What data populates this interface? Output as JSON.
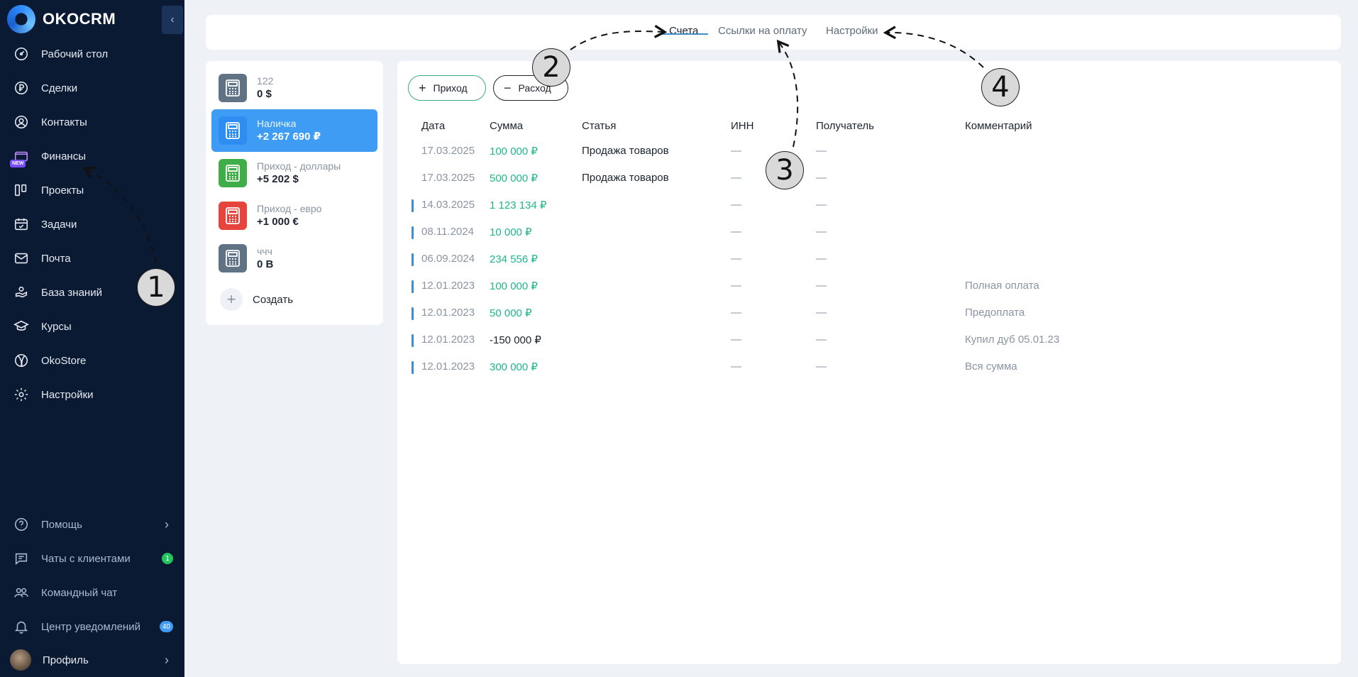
{
  "brand": {
    "name": "OKOCRM"
  },
  "sidebar": {
    "collapse_icon": "chevron-left-icon",
    "items": [
      {
        "label": "Рабочий стол",
        "icon": "dashboard-icon"
      },
      {
        "label": "Сделки",
        "icon": "ruble-circle-icon"
      },
      {
        "label": "Контакты",
        "icon": "user-circle-icon"
      },
      {
        "label": "Финансы",
        "icon": "wallet-icon",
        "badge": "NEW"
      },
      {
        "label": "Проекты",
        "icon": "kanban-icon"
      },
      {
        "label": "Задачи",
        "icon": "calendar-check-icon"
      },
      {
        "label": "Почта",
        "icon": "mail-icon"
      },
      {
        "label": "База знаний",
        "icon": "hand-book-icon"
      },
      {
        "label": "Курсы",
        "icon": "graduation-cap-icon"
      },
      {
        "label": "OkoStore",
        "icon": "globe-icon"
      },
      {
        "label": "Настройки",
        "icon": "gear-icon"
      }
    ],
    "bottom": [
      {
        "label": "Помощь",
        "icon": "question-icon"
      },
      {
        "label": "Чаты с клиентами",
        "icon": "chat-icon",
        "count": "1",
        "count_color": "#22c55e"
      },
      {
        "label": "Командный чат",
        "icon": "team-icon"
      },
      {
        "label": "Центр уведомлений",
        "icon": "bell-icon",
        "count": "40",
        "count_color": "#3e9cf5"
      },
      {
        "label": "Профиль",
        "icon": "avatar"
      }
    ]
  },
  "tabs": [
    {
      "label": "Счета",
      "active": true
    },
    {
      "label": "Ссылки на оплату",
      "active": false
    },
    {
      "label": "Настройки",
      "active": false
    }
  ],
  "accounts": {
    "items": [
      {
        "name": "122",
        "value": "0 $",
        "color": "#5f7385"
      },
      {
        "name": "Наличка",
        "value": "+2 267 690 ₽",
        "color": "#2f8cf0",
        "active": true
      },
      {
        "name": "Приход - доллары",
        "value": "+5 202 $",
        "color": "#3fae49"
      },
      {
        "name": "Приход - евро",
        "value": "+1 000 €",
        "color": "#e5453c"
      },
      {
        "name": "ччч",
        "value": "0 В",
        "color": "#5f7385"
      }
    ],
    "create_label": "Создать"
  },
  "actions": {
    "income": "Приход",
    "expense": "Расход"
  },
  "table": {
    "columns": [
      "Дата",
      "Сумма",
      "Статья",
      "ИНН",
      "Получатель",
      "Комментарий"
    ],
    "rows": [
      {
        "date": "17.03.2025",
        "sum": "100 000 ₽",
        "article": "Продажа товаров",
        "inn": "—",
        "recipient": "—",
        "comment": "",
        "marker": false
      },
      {
        "date": "17.03.2025",
        "sum": "500 000 ₽",
        "article": "Продажа товаров",
        "inn": "—",
        "recipient": "—",
        "comment": "",
        "marker": false
      },
      {
        "date": "14.03.2025",
        "sum": "1 123 134 ₽",
        "article": "",
        "inn": "—",
        "recipient": "—",
        "comment": "",
        "marker": true
      },
      {
        "date": "08.11.2024",
        "sum": "10 000 ₽",
        "article": "",
        "inn": "—",
        "recipient": "—",
        "comment": "",
        "marker": true
      },
      {
        "date": "06.09.2024",
        "sum": "234 556 ₽",
        "article": "",
        "inn": "—",
        "recipient": "—",
        "comment": "",
        "marker": true
      },
      {
        "date": "12.01.2023",
        "sum": "100 000 ₽",
        "article": "",
        "inn": "—",
        "recipient": "—",
        "comment": "Полная оплата",
        "marker": true
      },
      {
        "date": "12.01.2023",
        "sum": "50 000 ₽",
        "article": "",
        "inn": "—",
        "recipient": "—",
        "comment": "Предоплата",
        "marker": true
      },
      {
        "date": "12.01.2023",
        "sum": "-150 000 ₽",
        "article": "",
        "inn": "—",
        "recipient": "—",
        "comment": "Купил дуб 05.01.23",
        "marker": true,
        "negative": true
      },
      {
        "date": "12.01.2023",
        "sum": "300 000 ₽",
        "article": "",
        "inn": "—",
        "recipient": "—",
        "comment": "Вся сумма",
        "marker": true
      }
    ]
  },
  "annotations": [
    "1",
    "2",
    "3",
    "4"
  ]
}
